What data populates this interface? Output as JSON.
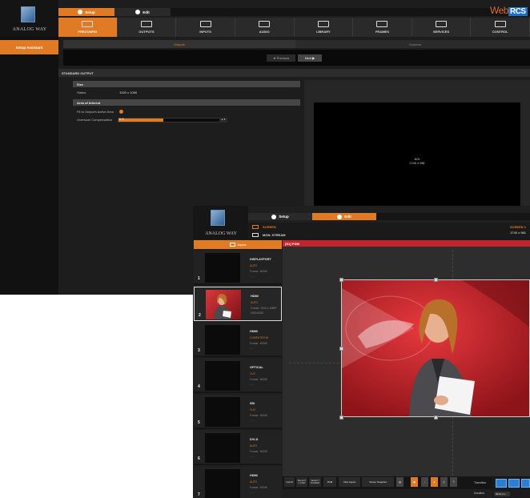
{
  "win1": {
    "logo_text": "ANALOG WAY",
    "mode_setup": "Setup",
    "mode_edit": "Edit",
    "webrcs_web": "Web",
    "webrcs_rcs": "RCS",
    "tabs": [
      {
        "label": "PRECONFIG",
        "icon": "preconfig-icon",
        "active": true
      },
      {
        "label": "OUTPUTS",
        "icon": "outputs-icon",
        "active": false
      },
      {
        "label": "INPUTS",
        "icon": "inputs-icon",
        "active": false
      },
      {
        "label": "AUDIO",
        "icon": "audio-icon",
        "active": false
      },
      {
        "label": "LIBRARY",
        "icon": "library-icon",
        "active": false
      },
      {
        "label": "FRAMES",
        "icon": "frames-icon",
        "active": false
      },
      {
        "label": "SERVICES",
        "icon": "services-icon",
        "active": false
      },
      {
        "label": "CONTROL",
        "icon": "control-icon",
        "active": false
      }
    ],
    "sidebar_item": "Setup Assistant",
    "step_active": "Outputs",
    "step_next": "Screens",
    "prev_label": "◄ Previous",
    "next_label": "Next ▶",
    "section_title": "STANDARD OUTPUT",
    "size_group": "Size",
    "status_label": "Status",
    "status_value": "1920 x 1080",
    "aoi_group": "Area of Interest",
    "fit_label": "Fit to Output's Active Area",
    "overscan_label": "Overscan Compensation",
    "overscan_value": "5 %",
    "overscan_fraction": 0.43,
    "preview_line1": "AOI",
    "preview_line2": "1740 x 981"
  },
  "win2": {
    "logo_text": "ANALOG WAY",
    "mode_setup": "Setup",
    "mode_edit": "Edit",
    "layer_screen": "SCREEN",
    "layer_mon": "MON. STREAM",
    "screen_name": "SCREEN 1",
    "screen_res": "1740 x 981",
    "inputs_header": "Inputs",
    "pgm_label": "[S1] PGM",
    "inputs": [
      {
        "num": "1",
        "name": "DISPLAYPORT",
        "sub": "AUTO",
        "fmt": "Format : NONE",
        "dash": "- - -"
      },
      {
        "num": "2",
        "name": "HDMI",
        "sub": "AUTO",
        "fmt": "Format : 1920 x 1080P",
        "dash": "1920x1080"
      },
      {
        "num": "3",
        "name": "HDMI",
        "sub": "COMPUTER HI",
        "fmt": "Format : NONE",
        "dash": "- - -"
      },
      {
        "num": "4",
        "name": "OPTICAL",
        "sub": "YUV",
        "fmt": "Format : NONE",
        "dash": "- - -"
      },
      {
        "num": "5",
        "name": "SDI",
        "sub": "YUV",
        "fmt": "Format : NONE",
        "dash": "- - -"
      },
      {
        "num": "6",
        "name": "DVI-D",
        "sub": "AUTO",
        "fmt": "Format : NONE",
        "dash": "- - -"
      },
      {
        "num": "7",
        "name": "HDMI",
        "sub": "AUTO",
        "fmt": "Format : NONE",
        "dash": "- - -"
      }
    ],
    "toolbar": {
      "clear": "CLEAR",
      "select_layer": "SELECT LAYER",
      "select_screen": "SELECT SCREEN",
      "pgm": "PGM",
      "view_layout": "View Layout",
      "screen_snapshot": "Screen Snapshot"
    },
    "transition_label": "Transition",
    "duration_label": "Duration",
    "duration_value": "00:01.0 s"
  }
}
